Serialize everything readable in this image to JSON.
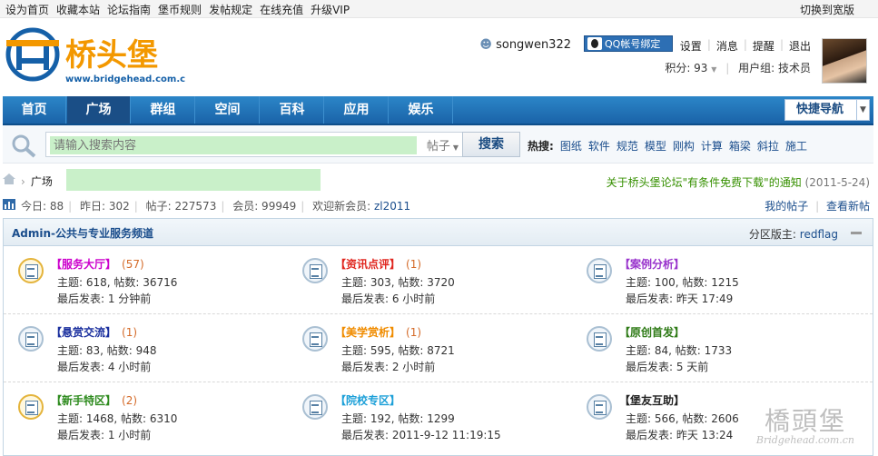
{
  "topbar": {
    "links": [
      "设为首页",
      "收藏本站",
      "论坛指南",
      "堡币规则",
      "发帖规定",
      "在线充值",
      "升级VIP"
    ],
    "right": "切换到宽版"
  },
  "logo": {
    "name": "桥头堡",
    "url": "www.bridgehead.com.cn"
  },
  "user": {
    "name": "songwen322",
    "qq_bind": "QQ帐号绑定",
    "links": [
      "设置",
      "消息",
      "提醒",
      "退出"
    ],
    "points": "积分: 93",
    "group": "用户组: 技术员"
  },
  "nav": {
    "items": [
      "首页",
      "广场",
      "群组",
      "空间",
      "百科",
      "应用",
      "娱乐"
    ],
    "active": 1,
    "quick": "快捷导航"
  },
  "search": {
    "placeholder": "请输入搜索内容",
    "type": "帖子",
    "button": "搜索",
    "hot_label": "热搜:",
    "hot": [
      "图纸",
      "软件",
      "规范",
      "模型",
      "刚构",
      "计算",
      "箱梁",
      "斜拉",
      "施工"
    ]
  },
  "breadcrumb": {
    "current": "广场",
    "notice": "关于桥头堡论坛\"有条件免费下载\"的通知",
    "notice_date": "(2011-5-24)"
  },
  "stats": {
    "today": "今日: 88",
    "yesterday": "昨日: 302",
    "posts": "帖子: 227573",
    "members": "会员: 99949",
    "welcome": "欢迎新会员:",
    "newest": "zl2011",
    "my_posts": "我的帖子",
    "new_posts": "查看新帖"
  },
  "panel": {
    "title": "Admin-公共与专业服务频道",
    "moderator_label": "分区版主:",
    "moderator": "redflag"
  },
  "forums": [
    {
      "name": "【服务大厅】",
      "color": "#cc00cc",
      "count": "(57)",
      "topics": "主题: 618, 帖数: 36716",
      "last": "最后发表: 1 分钟前",
      "new": true
    },
    {
      "name": "【资讯点评】",
      "color": "#e0261f",
      "count": "(1)",
      "topics": "主题: 303, 帖数: 3720",
      "last": "最后发表: 6 小时前",
      "new": false
    },
    {
      "name": "【案例分析】",
      "color": "#9933cc",
      "count": "",
      "topics": "主题: 100, 帖数: 1215",
      "last": "最后发表: 昨天 17:49",
      "new": false
    },
    {
      "name": "【悬赏交流】",
      "color": "#1a2f9e",
      "count": "(1)",
      "topics": "主题: 83, 帖数: 948",
      "last": "最后发表: 4 小时前",
      "new": false
    },
    {
      "name": "【美学赏析】",
      "color": "#f08c00",
      "count": "(1)",
      "topics": "主题: 595, 帖数: 8721",
      "last": "最后发表: 2 小时前",
      "new": false
    },
    {
      "name": "【原创首发】",
      "color": "#2f7b17",
      "count": "",
      "topics": "主题: 84, 帖数: 1733",
      "last": "最后发表: 5 天前",
      "new": false
    },
    {
      "name": "【新手特区】",
      "color": "#2e8b1e",
      "count": "(2)",
      "topics": "主题: 1468, 帖数: 6310",
      "last": "最后发表: 1 小时前",
      "new": true
    },
    {
      "name": "【院校专区】",
      "color": "#1da0d8",
      "count": "",
      "topics": "主题: 192, 帖数: 1299",
      "last": "最后发表: 2011-9-12 11:19:15",
      "new": false
    },
    {
      "name": "【堡友互助】",
      "color": "#222222",
      "count": "",
      "topics": "主题: 566, 帖数: 2606",
      "last": "最后发表: 昨天 13:24",
      "new": false
    }
  ],
  "watermark": {
    "cn": "橋頭堡",
    "en": "Bridgehead.com.cn"
  }
}
